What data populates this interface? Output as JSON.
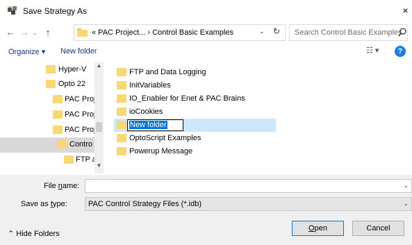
{
  "window": {
    "title": "Save Strategy As",
    "close_label": "×"
  },
  "nav": {
    "back_label": "←",
    "forward_label": "→",
    "recent_label": "⌄",
    "up_label": "↑",
    "breadcrumb": "« PAC Project...  ›  Control Basic Examples",
    "refresh_label": "↻",
    "search_placeholder": "Search Control Basic Examples"
  },
  "toolbar": {
    "organize_label": "Organize ▾",
    "new_folder_label": "New folder",
    "view_label": "☷ ▾",
    "help_label": "?"
  },
  "nav_pane": {
    "items": [
      {
        "label": "Hyper-V"
      },
      {
        "label": "Opto 22"
      },
      {
        "label": "PAC Proj"
      },
      {
        "label": "PAC Proj"
      },
      {
        "label": "PAC Proj"
      },
      {
        "label": "Contro"
      },
      {
        "label": "FTP a"
      }
    ]
  },
  "files": {
    "items": [
      {
        "label": "FTP and Data Logging"
      },
      {
        "label": "InitVariables"
      },
      {
        "label": "IO_Enabler for Enet & PAC Brains"
      },
      {
        "label": "ioCookies"
      },
      {
        "label": "New folder"
      },
      {
        "label": "OptoScript Examples"
      },
      {
        "label": "Powerup Message"
      }
    ]
  },
  "form": {
    "file_name_label_pre": "File ",
    "file_name_label_u": "n",
    "file_name_label_post": "ame:",
    "file_name_value": "",
    "save_type_label_pre": "Save as ",
    "save_type_label_u": "t",
    "save_type_label_post": "ype:",
    "save_type_value": "PAC Control Strategy Files (*.idb)"
  },
  "footer": {
    "hide_folders_label": "⌃  Hide Folders",
    "open_label_u": "O",
    "open_label_rest": "pen",
    "cancel_label": "Cancel"
  },
  "colors": {
    "folder": "#f8d775",
    "accent": "#0078d7",
    "selection": "#cce8ff",
    "link": "#1e3287"
  }
}
